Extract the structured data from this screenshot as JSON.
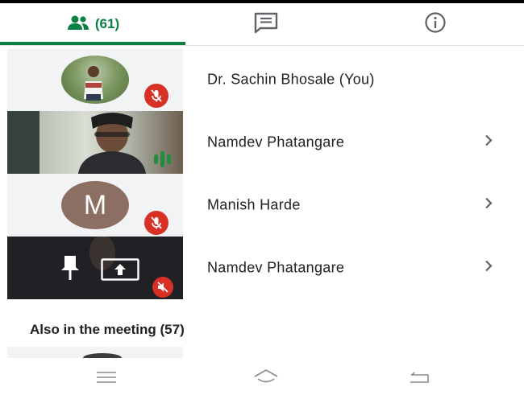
{
  "tabs": {
    "people_count": "(61)",
    "people_icon": "people-icon",
    "chat_icon": "chat-icon",
    "info_icon": "info-icon"
  },
  "participants": [
    {
      "name": "Dr. Sachin Bhosale (You)",
      "tile": "photo-avatar",
      "muted": true
    },
    {
      "name": "Namdev Phatangare",
      "tile": "video",
      "speaking": true
    },
    {
      "name": "Manish Harde",
      "tile": "letter-avatar",
      "initial": "M",
      "muted": true
    },
    {
      "name": "Namdev Phatangare",
      "tile": "video-dark",
      "pinned": true,
      "presenting": true,
      "muted": true
    }
  ],
  "also_in_meeting": "Also in the meeting (57)",
  "colors": {
    "accent": "#0b8043",
    "mute_red": "#d93025",
    "speaking_green": "#1e8e3e",
    "avatar_brown": "#8d6e63"
  },
  "navbar": {
    "menu_icon": "menu-icon",
    "home_icon": "home-icon",
    "back_icon": "back-icon"
  }
}
